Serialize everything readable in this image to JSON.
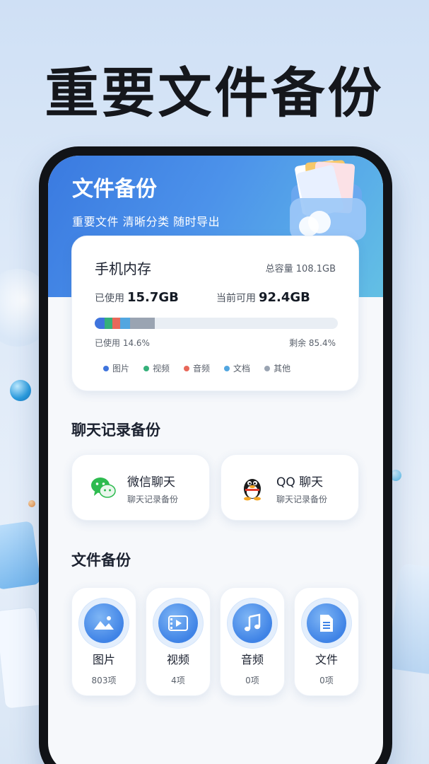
{
  "promo": {
    "headline": "重要文件备份"
  },
  "app": {
    "title": "文件备份",
    "subtitle": "重要文件 清晰分类  随时导出"
  },
  "storage": {
    "title": "手机内存",
    "total_label": "总容量 108.1GB",
    "used_label": "已使用",
    "used_value": "15.7GB",
    "avail_label": "当前可用",
    "avail_value": "92.4GB",
    "used_pct_label": "已使用 14.6%",
    "remain_label": "剩余 85.4%",
    "used_fraction": 0.146,
    "segments": [
      {
        "name": "图片",
        "fraction": 0.04,
        "color": "#3f74dd"
      },
      {
        "name": "视频",
        "fraction": 0.032,
        "color": "#35b07a"
      },
      {
        "name": "音频",
        "fraction": 0.034,
        "color": "#e8685a"
      },
      {
        "name": "文档",
        "fraction": 0.04,
        "color": "#52a6e0"
      },
      {
        "name": "其他",
        "fraction": 0.1,
        "color": "#9aa4b2"
      }
    ],
    "legend": [
      {
        "label": "图片",
        "color": "#3f74dd"
      },
      {
        "label": "视频",
        "color": "#35b07a"
      },
      {
        "label": "音频",
        "color": "#e8685a"
      },
      {
        "label": "文档",
        "color": "#52a6e0"
      },
      {
        "label": "其他",
        "color": "#9aa4b2"
      }
    ]
  },
  "chat_section": {
    "title": "聊天记录备份",
    "items": [
      {
        "name": "微信聊天",
        "sub": "聊天记录备份",
        "icon": "wechat-icon"
      },
      {
        "name": "QQ 聊天",
        "sub": "聊天记录备份",
        "icon": "qq-icon"
      }
    ]
  },
  "file_section": {
    "title": "文件备份",
    "items": [
      {
        "name": "图片",
        "count": "803项",
        "icon": "image-icon"
      },
      {
        "name": "视频",
        "count": "4项",
        "icon": "video-icon"
      },
      {
        "name": "音频",
        "count": "0项",
        "icon": "music-icon"
      },
      {
        "name": "文件",
        "count": "0项",
        "icon": "document-icon"
      }
    ]
  }
}
